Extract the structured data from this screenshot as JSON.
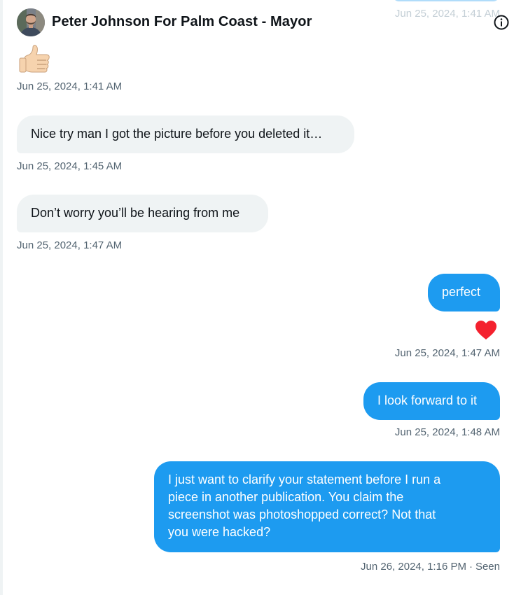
{
  "conversation": {
    "title": "Peter Johnson For Palm Coast - Mayor",
    "avatar_icon": "profile-photo",
    "info_icon": "info-circle-icon",
    "previous_timestamp": "Jun 25, 2024, 1:41 AM"
  },
  "colors": {
    "outgoing_bubble": "#1d9bf0",
    "incoming_bubble": "#eff3f4",
    "timestamp": "#536471",
    "reaction_heart": "#f4212e"
  },
  "messages": [
    {
      "direction": "incoming",
      "emoji": "thumbs-up-icon",
      "timestamp": "Jun 25, 2024, 1:41 AM"
    },
    {
      "direction": "incoming",
      "text": "Nice try man I got the picture before you deleted it…",
      "timestamp": "Jun 25, 2024, 1:45 AM"
    },
    {
      "direction": "incoming",
      "text": "Don’t worry you’ll be hearing from me",
      "timestamp": "Jun 25, 2024, 1:47 AM"
    },
    {
      "direction": "outgoing",
      "text": "perfect",
      "reaction": "heart-icon",
      "timestamp": "Jun 25, 2024, 1:47 AM"
    },
    {
      "direction": "outgoing",
      "text": "I look forward to it",
      "timestamp": "Jun 25, 2024, 1:48 AM"
    },
    {
      "direction": "outgoing",
      "lines": [
        "I just want to clarify your statement before I run a",
        "piece in another publication.  You claim the",
        "screenshot was photoshopped correct?  Not that",
        "you were hacked?"
      ],
      "timestamp": "Jun 26, 2024, 1:16 PM",
      "status": "Seen"
    }
  ]
}
